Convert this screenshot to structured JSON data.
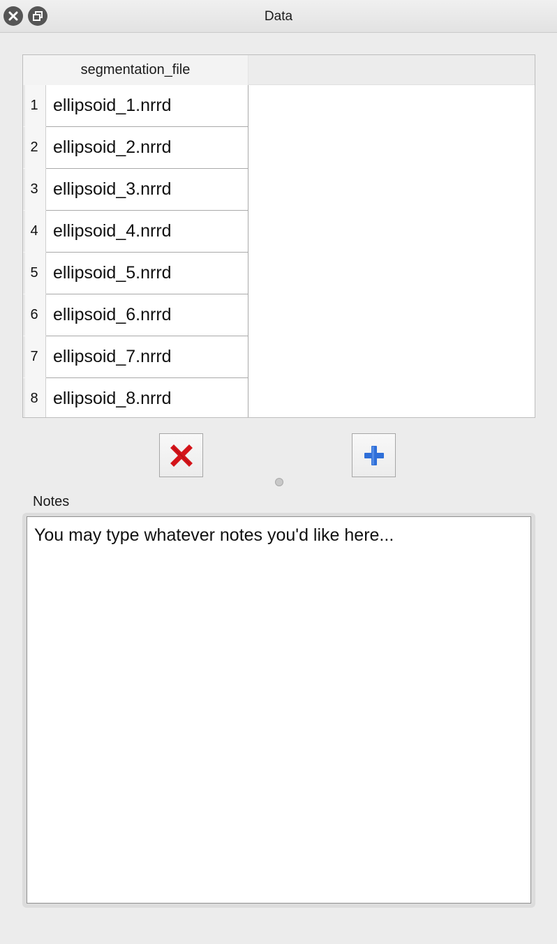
{
  "window": {
    "title": "Data",
    "close_icon": "close-icon",
    "float_icon": "float-icon"
  },
  "table": {
    "column_header": "segmentation_file",
    "rows": [
      {
        "index": "1",
        "file": "ellipsoid_1.nrrd"
      },
      {
        "index": "2",
        "file": "ellipsoid_2.nrrd"
      },
      {
        "index": "3",
        "file": "ellipsoid_3.nrrd"
      },
      {
        "index": "4",
        "file": "ellipsoid_4.nrrd"
      },
      {
        "index": "5",
        "file": "ellipsoid_5.nrrd"
      },
      {
        "index": "6",
        "file": "ellipsoid_6.nrrd"
      },
      {
        "index": "7",
        "file": "ellipsoid_7.nrrd"
      },
      {
        "index": "8",
        "file": "ellipsoid_8.nrrd"
      }
    ]
  },
  "buttons": {
    "remove_icon": "red-x-icon",
    "add_icon": "blue-plus-icon",
    "remove_color": "#d4141a",
    "add_color": "#2f6fd8"
  },
  "notes": {
    "label": "Notes",
    "text": "You may type whatever notes you'd like here..."
  }
}
